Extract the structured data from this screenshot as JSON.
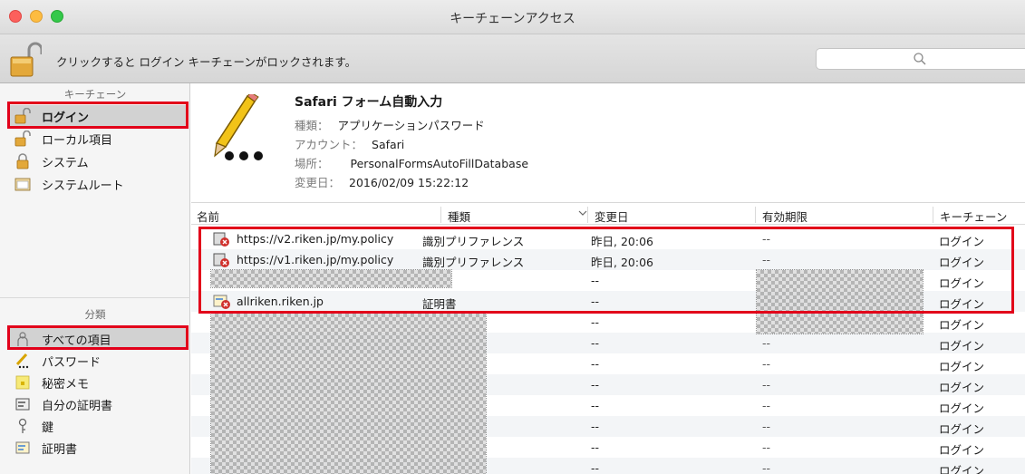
{
  "window": {
    "title": "キーチェーンアクセス"
  },
  "toolbar": {
    "lock_message": "クリックすると ログイン キーチェーンがロックされます。"
  },
  "sidebar": {
    "keychains_header": "キーチェーン",
    "keychains": [
      {
        "label": "ログイン",
        "icon": "unlocked-padlock-icon"
      },
      {
        "label": "ローカル項目",
        "icon": "unlocked-padlock-icon"
      },
      {
        "label": "システム",
        "icon": "locked-padlock-icon"
      },
      {
        "label": "システムルート",
        "icon": "folder-certificate-icon"
      }
    ],
    "category_header": "分類",
    "categories": [
      {
        "label": "すべての項目",
        "icon": "people-icon"
      },
      {
        "label": "パスワード",
        "icon": "pencil-password-icon"
      },
      {
        "label": "秘密メモ",
        "icon": "secure-note-icon"
      },
      {
        "label": "自分の証明書",
        "icon": "my-certificate-icon"
      },
      {
        "label": "鍵",
        "icon": "key-icon"
      },
      {
        "label": "証明書",
        "icon": "certificate-icon"
      }
    ]
  },
  "detail": {
    "title": "Safari フォーム自動入力",
    "kind_label": "種類：",
    "kind_value": "アプリケーションパスワード",
    "account_label": "アカウント：",
    "account_value": "Safari",
    "where_label": "場所：",
    "where_value": "PersonalFormsAutoFillDatabase",
    "modified_label": "変更日：",
    "modified_value": "2016/02/09 15:22:12"
  },
  "table": {
    "columns": {
      "name": "名前",
      "kind": "種類",
      "date": "変更日",
      "expires": "有効期限",
      "keychain": "キーチェーン"
    },
    "rows": [
      {
        "name": "https://v2.riken.jp/my.policy",
        "kind": "識別プリファレンス",
        "date": "昨日, 20:06",
        "expires": "--",
        "keychain": "ログイン"
      },
      {
        "name": "https://v1.riken.jp/my.policy",
        "kind": "識別プリファレンス",
        "date": "昨日, 20:06",
        "expires": "--",
        "keychain": "ログイン"
      },
      {
        "name": "",
        "kind": "",
        "date": "--",
        "expires": "",
        "keychain": "ログイン"
      },
      {
        "name": "allriken.riken.jp",
        "kind": "証明書",
        "date": "--",
        "expires": "",
        "keychain": "ログイン"
      },
      {
        "name": "",
        "kind": "",
        "date": "--",
        "expires": "",
        "keychain": "ログイン"
      },
      {
        "name": "",
        "kind": "",
        "date": "--",
        "expires": "--",
        "keychain": "ログイン"
      },
      {
        "name": "",
        "kind": "",
        "date": "--",
        "expires": "--",
        "keychain": "ログイン"
      },
      {
        "name": "",
        "kind": "",
        "date": "--",
        "expires": "--",
        "keychain": "ログイン"
      },
      {
        "name": "",
        "kind": "",
        "date": "--",
        "expires": "--",
        "keychain": "ログイン"
      },
      {
        "name": "",
        "kind": "",
        "date": "--",
        "expires": "--",
        "keychain": "ログイン"
      },
      {
        "name": "",
        "kind": "",
        "date": "--",
        "expires": "--",
        "keychain": "ログイン"
      },
      {
        "name": "",
        "kind": "",
        "date": "--",
        "expires": "--",
        "keychain": "ログイン"
      }
    ]
  },
  "colors": {
    "highlight_box": "#e2001a",
    "selection": "#d2d2d2"
  }
}
